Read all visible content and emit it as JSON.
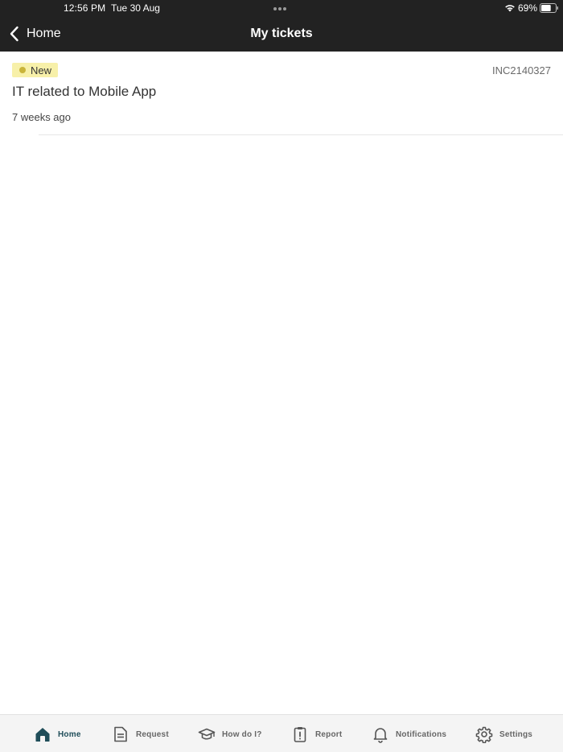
{
  "status_bar": {
    "time": "12:56 PM",
    "date": "Tue 30 Aug",
    "battery_percent": "69%",
    "battery_level": 0.69,
    "icons": [
      "wifi-icon",
      "battery-icon",
      "multitasking-dots-icon"
    ]
  },
  "nav": {
    "back_label": "Home",
    "title": "My tickets",
    "back_icon": "chevron-left-icon"
  },
  "tickets": [
    {
      "status": "New",
      "number": "INC2140327",
      "title": "IT related to Mobile App",
      "age": "7 weeks ago"
    }
  ],
  "tabs": [
    {
      "label": "Home",
      "icon": "home-icon",
      "active": true
    },
    {
      "label": "Request",
      "icon": "document-icon",
      "active": false
    },
    {
      "label": "How do I?",
      "icon": "graduation-cap-icon",
      "active": false
    },
    {
      "label": "Report",
      "icon": "clipboard-alert-icon",
      "active": false
    },
    {
      "label": "Notifications",
      "icon": "bell-icon",
      "active": false
    },
    {
      "label": "Settings",
      "icon": "gear-icon",
      "active": false
    }
  ],
  "colors": {
    "header_bg": "#222222",
    "badge_bg": "#f7f0a9",
    "badge_dot": "#c9b43a",
    "active_tab": "#1f4d59",
    "inactive_tab": "#666666"
  }
}
